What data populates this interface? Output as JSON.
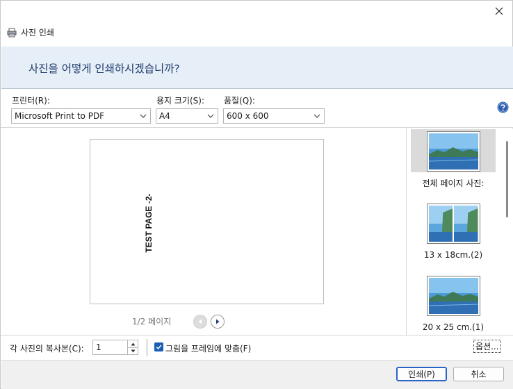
{
  "window": {
    "title": "사진 인쇄",
    "heading": "사진을 어떻게 인쇄하시겠습니까?"
  },
  "toolbar": {
    "printer_label": "프린터(R):",
    "printer_value": "Microsoft Print to PDF",
    "paper_label": "용지 크기(S):",
    "paper_value": "A4",
    "quality_label": "품질(Q):",
    "quality_value": "600 x 600"
  },
  "preview": {
    "page_text": "TEST PAGE -2-",
    "pager": "1/2 페이지"
  },
  "layouts": {
    "items": [
      {
        "label": "전체 페이지 사진:",
        "selected": true
      },
      {
        "label": "13 x 18cm.(2)",
        "selected": false
      },
      {
        "label": "20 x 25 cm.(1)",
        "selected": false
      }
    ]
  },
  "bottom": {
    "copies_label": "각 사진의 복사본(C):",
    "copies_value": "1",
    "fit_label": "그림을 프레임에 맞춤(F)",
    "fit_checked": true,
    "options_label": "옵션..."
  },
  "footer": {
    "print_label": "인쇄(P)",
    "cancel_label": "취소"
  },
  "colors": {
    "banner_bg": "#e6eef8",
    "heading_text": "#1e3c6b",
    "accent": "#1a5fb4"
  }
}
